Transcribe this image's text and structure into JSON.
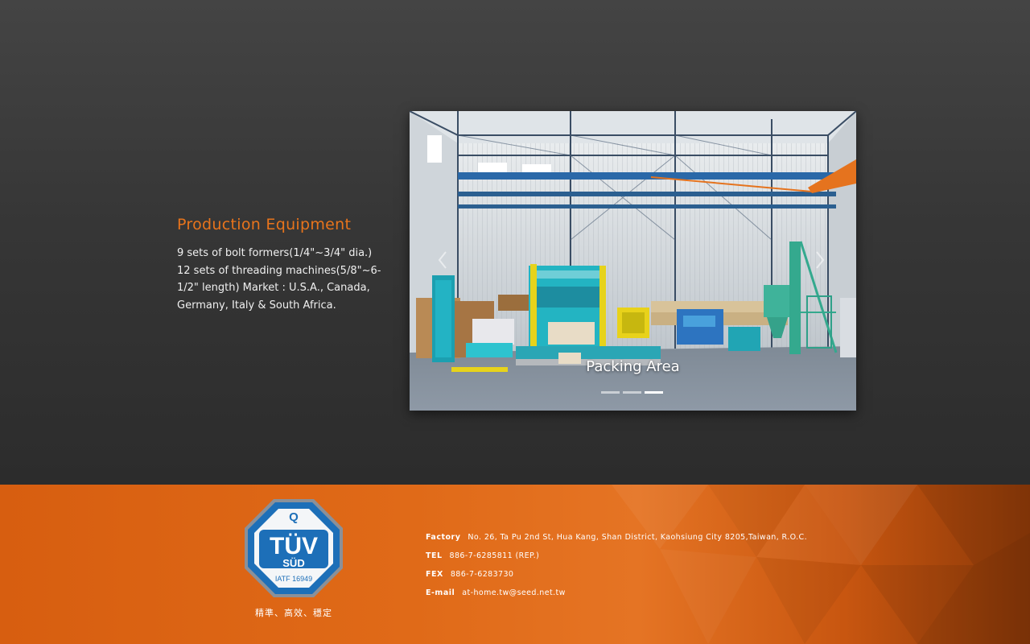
{
  "section": {
    "title": "Production Equipment",
    "description": "9 sets of bolt formers(1/4\"~3/4\" dia.)\n12 sets of threading machines(5/8\"~6-\n1/2\" length) Market : U.S.A., Canada,\nGermany, Italy & South Africa."
  },
  "slider": {
    "caption": "Packing Area",
    "prev_icon": "chevron-left-icon",
    "next_icon": "chevron-right-icon",
    "slide_count": 3,
    "active_slide": 3
  },
  "footer": {
    "logo_text": {
      "brand": "TÜV",
      "sub": "SÜD",
      "cert": "IATF 16949",
      "top_mark": "Q"
    },
    "logo_caption": "精準、高效、穩定",
    "contact": {
      "factory_label": "Factory",
      "factory_value": "No. 26, Ta Pu 2nd St, Hua Kang, Shan District, Kaohsiung City 8205,Taiwan, R.O.C.",
      "tel_label": "TEL",
      "tel_value": "886-7-6285811 (REP.)",
      "fax_label": "FEX",
      "fax_value": "886-7-6283730",
      "email_label": "E-mail",
      "email_value": "at-home.tw@seed.net.tw"
    }
  },
  "colors": {
    "accent": "#e8741c",
    "footer_orange": "#e06a18",
    "tuv_blue": "#1d6fb8"
  }
}
